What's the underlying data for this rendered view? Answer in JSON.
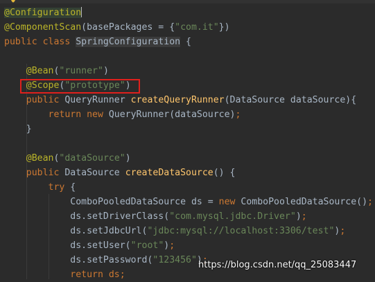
{
  "editor": {
    "lines": [
      {
        "tokens": [
          {
            "t": "@Configuration",
            "c": "ann hl-word"
          },
          {
            "t": "",
            "c": "caret"
          }
        ]
      },
      {
        "tokens": [
          {
            "t": "@ComponentScan",
            "c": "ann"
          },
          {
            "t": "(basePackages = {",
            "c": ""
          },
          {
            "t": "\"com.it\"",
            "c": "str"
          },
          {
            "t": "})",
            "c": ""
          }
        ]
      },
      {
        "tokens": [
          {
            "t": "public class ",
            "c": "kw"
          },
          {
            "t": "SpringConfiguration",
            "c": "hl-cls"
          },
          {
            "t": " {",
            "c": ""
          }
        ]
      },
      {
        "tokens": []
      },
      {
        "tokens": [
          {
            "t": "    @Bean",
            "c": "ann"
          },
          {
            "t": "(",
            "c": ""
          },
          {
            "t": "\"runner\"",
            "c": "str"
          },
          {
            "t": ")",
            "c": ""
          }
        ]
      },
      {
        "tokens": [
          {
            "t": "    @Scope",
            "c": "ann"
          },
          {
            "t": "(",
            "c": ""
          },
          {
            "t": "\"prototype\"",
            "c": "str"
          },
          {
            "t": ")",
            "c": ""
          }
        ]
      },
      {
        "tokens": [
          {
            "t": "    public ",
            "c": "kw"
          },
          {
            "t": "QueryRunner ",
            "c": ""
          },
          {
            "t": "createQueryRunner",
            "c": "fn"
          },
          {
            "t": "(DataSource dataSource){",
            "c": ""
          }
        ]
      },
      {
        "tokens": [
          {
            "t": "        return new ",
            "c": "kw"
          },
          {
            "t": "QueryRunner(dataSource)",
            "c": ""
          },
          {
            "t": ";",
            "c": "kw"
          }
        ]
      },
      {
        "tokens": [
          {
            "t": "    }",
            "c": ""
          }
        ]
      },
      {
        "tokens": []
      },
      {
        "tokens": [
          {
            "t": "    @Bean",
            "c": "ann"
          },
          {
            "t": "(",
            "c": ""
          },
          {
            "t": "\"dataSource\"",
            "c": "str"
          },
          {
            "t": ")",
            "c": ""
          }
        ]
      },
      {
        "tokens": [
          {
            "t": "    public ",
            "c": "kw"
          },
          {
            "t": "DataSource ",
            "c": ""
          },
          {
            "t": "createDataSource",
            "c": "fn"
          },
          {
            "t": "() {",
            "c": ""
          }
        ]
      },
      {
        "tokens": [
          {
            "t": "        try ",
            "c": "kw"
          },
          {
            "t": "{",
            "c": ""
          }
        ]
      },
      {
        "tokens": [
          {
            "t": "            ComboPooledDataSource ds = ",
            "c": ""
          },
          {
            "t": "new ",
            "c": "kw"
          },
          {
            "t": "ComboPooledDataSource()",
            "c": ""
          },
          {
            "t": ";",
            "c": "kw"
          }
        ]
      },
      {
        "tokens": [
          {
            "t": "            ds.setDriverClass(",
            "c": ""
          },
          {
            "t": "\"com.mysql.jdbc.Driver\"",
            "c": "str"
          },
          {
            "t": ")",
            "c": ""
          },
          {
            "t": ";",
            "c": "kw"
          }
        ]
      },
      {
        "tokens": [
          {
            "t": "            ds.setJdbcUrl(",
            "c": ""
          },
          {
            "t": "\"jdbc:mysql://localhost:3306/test\"",
            "c": "str"
          },
          {
            "t": ")",
            "c": ""
          },
          {
            "t": ";",
            "c": "kw"
          }
        ]
      },
      {
        "tokens": [
          {
            "t": "            ds.setUser(",
            "c": ""
          },
          {
            "t": "\"root\"",
            "c": "str"
          },
          {
            "t": ")",
            "c": ""
          },
          {
            "t": ";",
            "c": "kw"
          }
        ]
      },
      {
        "tokens": [
          {
            "t": "            ds.setPassword(",
            "c": ""
          },
          {
            "t": "\"123456\"",
            "c": "str"
          },
          {
            "t": ")",
            "c": ""
          },
          {
            "t": ";",
            "c": "kw"
          }
        ]
      },
      {
        "tokens": [
          {
            "t": "            return ds",
            "c": "kw"
          },
          {
            "t": ";",
            "c": "kw"
          }
        ]
      }
    ]
  },
  "watermark": {
    "text": "https://blog.csdn.net/qq_25083447"
  },
  "colors": {
    "background": "#2b2b2b",
    "keyword": "#cc7832",
    "annotation": "#bbb529",
    "string": "#6a8759",
    "method": "#ffc66d",
    "plain": "#a9b7c6",
    "highlight_box": "#e0201c"
  },
  "icons": {
    "gutter": "lightbulb-icon"
  }
}
